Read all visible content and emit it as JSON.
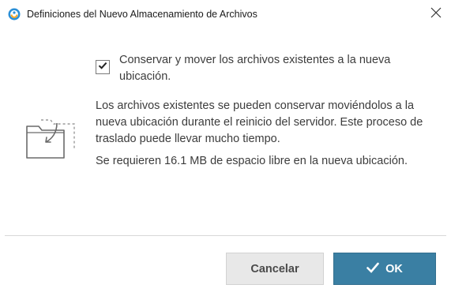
{
  "window": {
    "title": "Definiciones del Nuevo Almacenamiento de Archivos",
    "app_icon": "app-logo-icon",
    "close_icon": "close-icon"
  },
  "option": {
    "checked": true,
    "label": "Conservar y mover los archivos existentes a la nueva ubicación."
  },
  "info": {
    "icon": "folder-move-icon",
    "paragraph1": "Los archivos existentes se pueden conservar moviéndolos a la nueva ubicación durante el reinicio del servidor. Este proceso de traslado puede llevar mucho tiempo.",
    "paragraph2": "Se requieren 16.1 MB de espacio libre en la nueva ubicación."
  },
  "buttons": {
    "cancel_label": "Cancelar",
    "ok_label": "OK",
    "ok_icon": "checkmark-icon"
  },
  "colors": {
    "ok_button": "#3a7fa3",
    "cancel_button": "#e8e8e8",
    "app_icon_blue": "#2b8fd6",
    "app_icon_orange": "#f5a623"
  }
}
